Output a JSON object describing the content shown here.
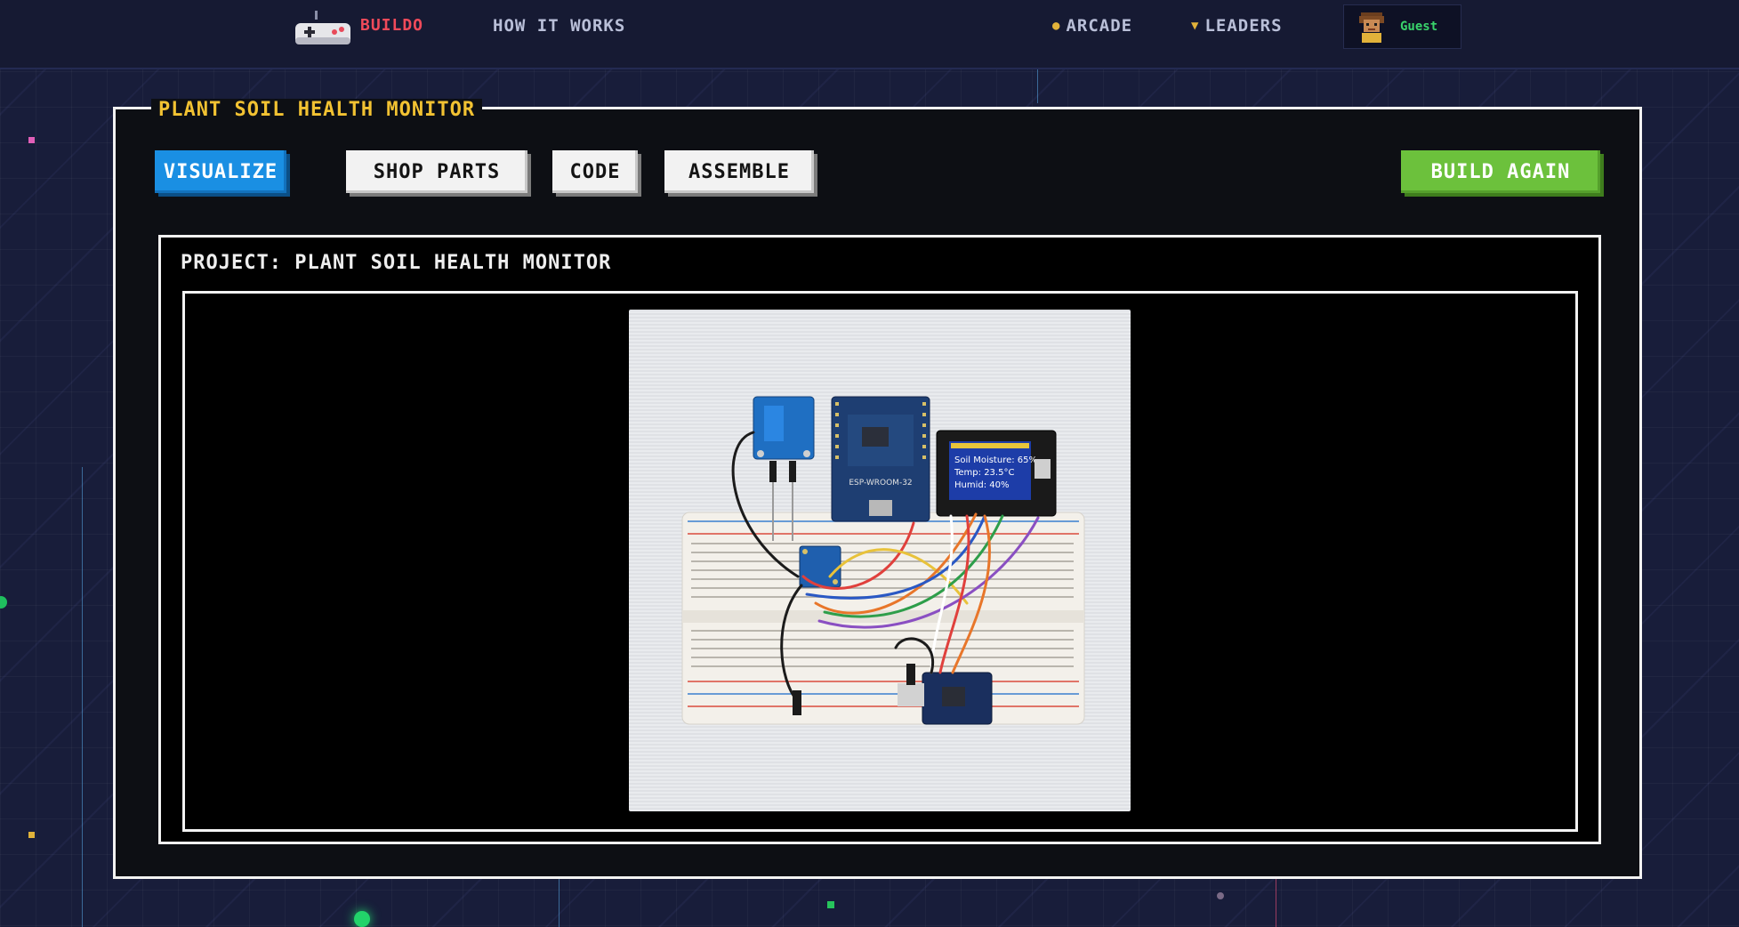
{
  "nav": {
    "brand": "BUILDO",
    "how_it_works": "HOW IT WORKS",
    "arcade": "ARCADE",
    "leaders": "LEADERS",
    "user": "Guest"
  },
  "panel": {
    "title": "PLANT SOIL HEALTH MONITOR",
    "tabs": [
      "VISUALIZE",
      "SHOP PARTS",
      "CODE",
      "ASSEMBLE"
    ],
    "build_again": "BUILD AGAIN",
    "project_label": "PROJECT: PLANT SOIL HEALTH MONITOR"
  },
  "render": {
    "oled_lines": [
      "Soil Moisture: 65%",
      "Temp:  23.5°C",
      "Humid:  40%"
    ],
    "esp_label": "ESP-WROOM-32",
    "breadboard_colors": {
      "board": "#f3f0ea",
      "red_rail": "#d94a3c",
      "blue_rail": "#3a7fd0"
    }
  },
  "colors": {
    "accent_blue": "#1a8fe3",
    "accent_green": "#6cc13c",
    "brand_red": "#f04a5a",
    "title_yellow": "#f2c232"
  }
}
